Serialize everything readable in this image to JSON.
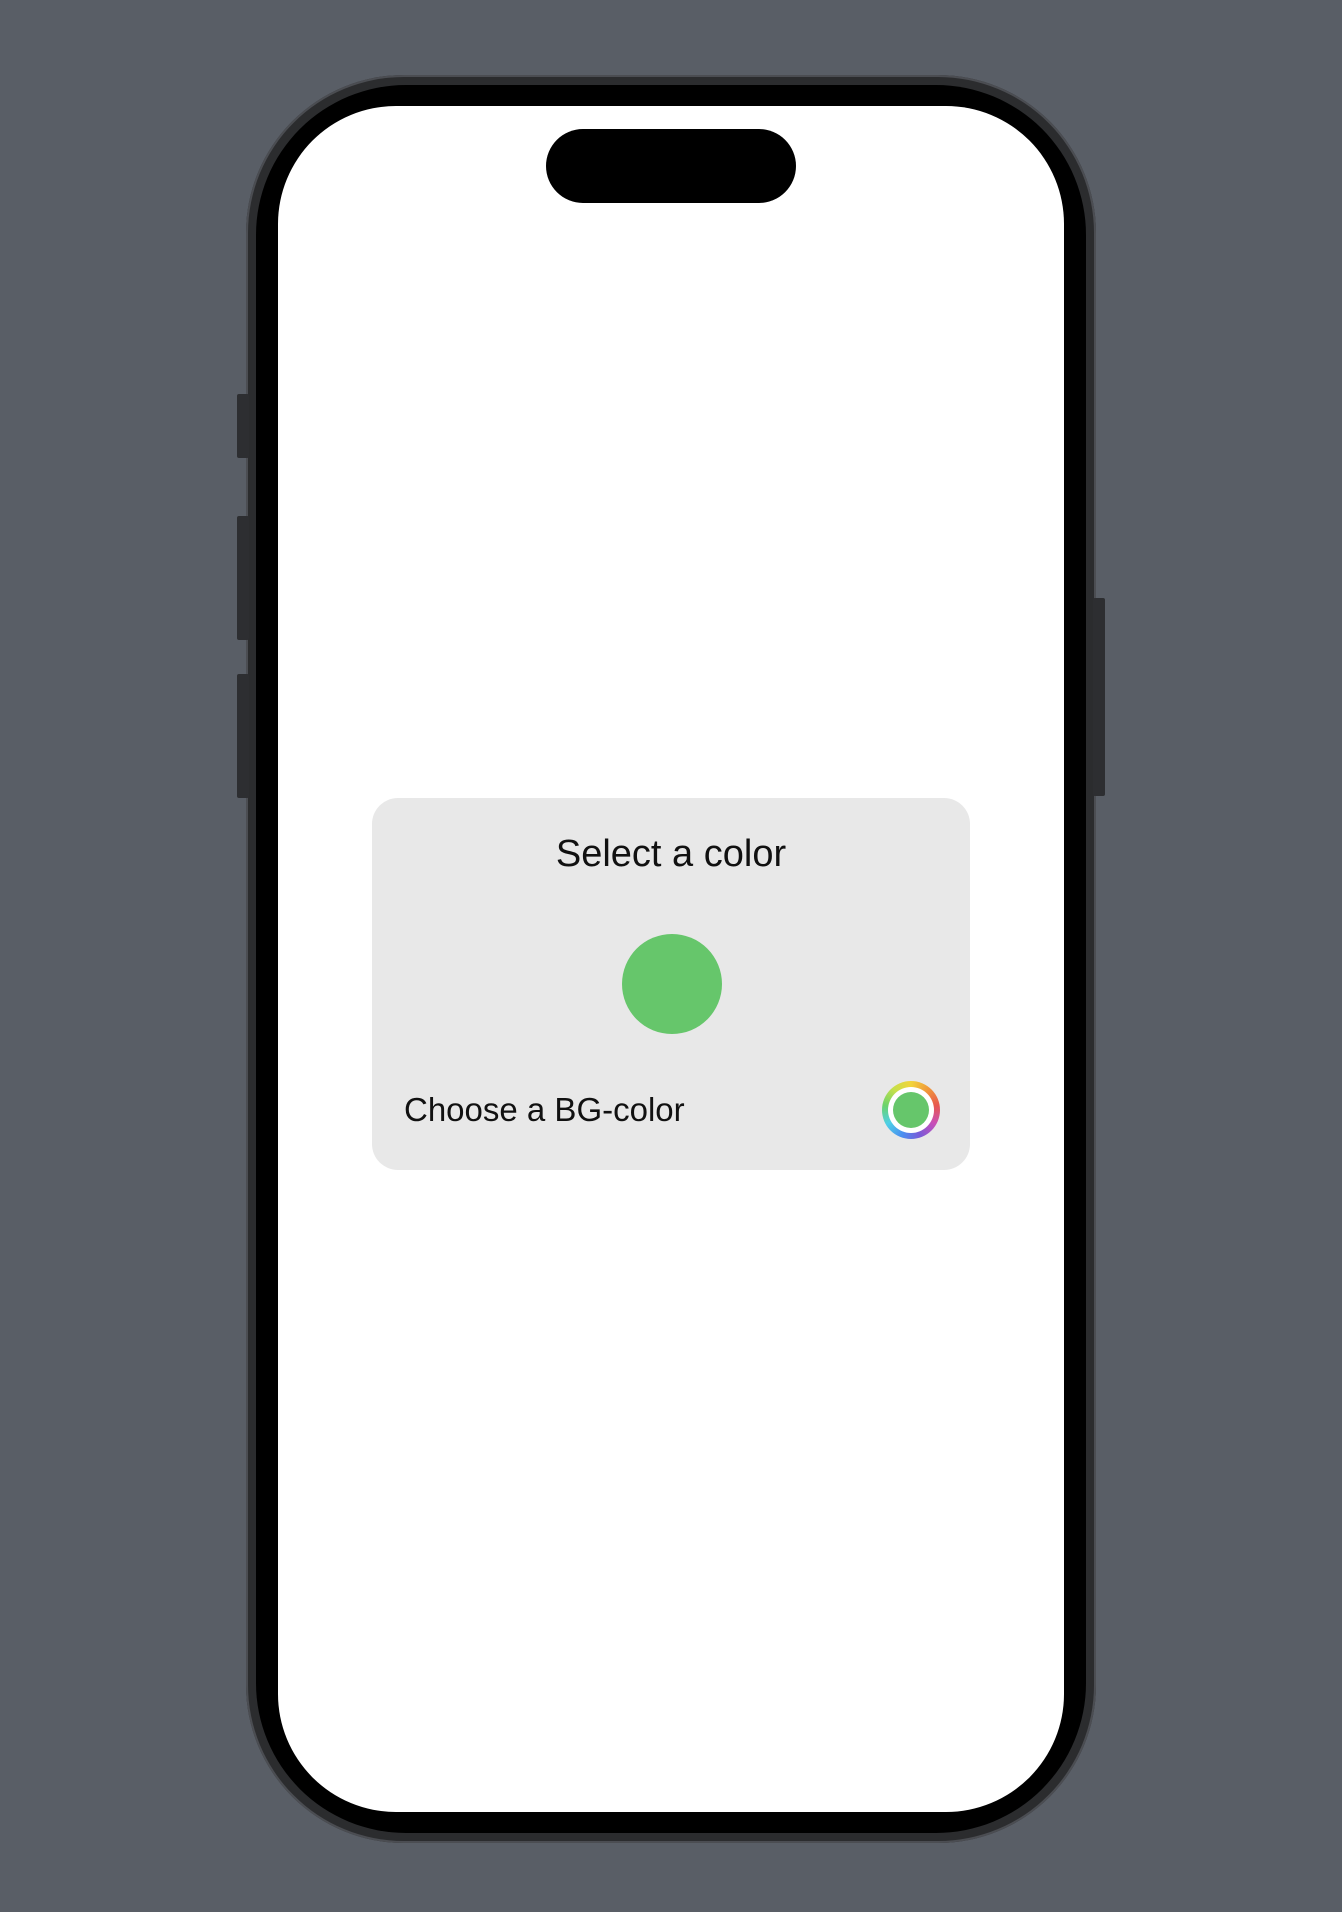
{
  "card": {
    "title": "Select a color",
    "selected_color": "#66c66b"
  },
  "picker": {
    "label": "Choose a BG-color",
    "selected_color": "#66c66b"
  },
  "colors": {
    "desktop_background": "#595e66",
    "screen_background": "#ffffff",
    "card_background": "#e8e8e8"
  }
}
